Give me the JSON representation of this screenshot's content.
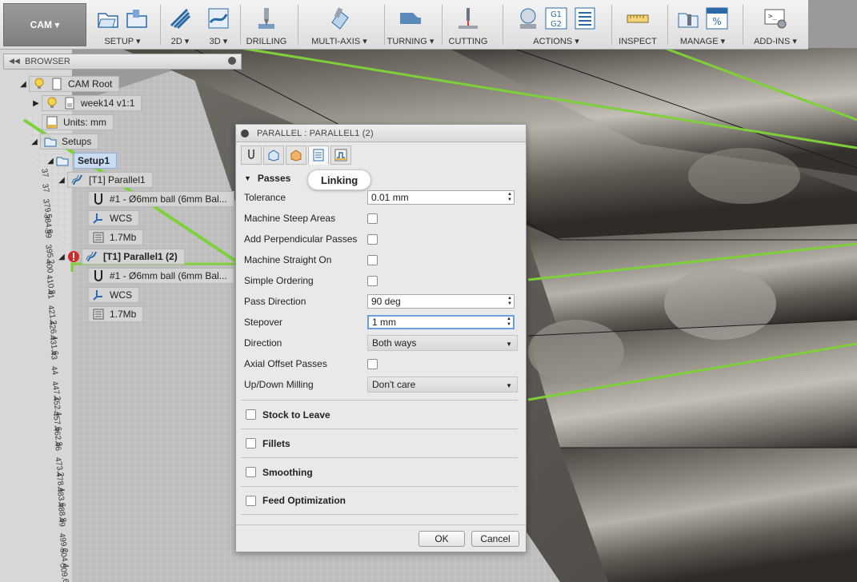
{
  "toolbar": {
    "cam_label": "CAM",
    "groups": [
      {
        "label": "SETUP"
      },
      {
        "label": "2D"
      },
      {
        "label": "3D"
      },
      {
        "label": "DRILLING"
      },
      {
        "label": "MULTI-AXIS"
      },
      {
        "label": "TURNING"
      },
      {
        "label": "CUTTING"
      },
      {
        "label": "ACTIONS"
      },
      {
        "label": "INSPECT"
      },
      {
        "label": "MANAGE"
      },
      {
        "label": "ADD-INS"
      }
    ]
  },
  "browser": {
    "title": "BROWSER",
    "items": [
      {
        "label": "CAM Root"
      },
      {
        "label": "week14 v1:1"
      },
      {
        "label": "Units: mm"
      },
      {
        "label": "Setups"
      },
      {
        "label": "Setup1"
      },
      {
        "label": "[T1] Parallel1"
      },
      {
        "label": "#1 - Ø6mm ball (6mm Bal..."
      },
      {
        "label": "WCS"
      },
      {
        "label": "1.7Mb"
      },
      {
        "label": "[T1] Parallel1 (2)"
      },
      {
        "label": "#1 - Ø6mm ball (6mm Bal..."
      },
      {
        "label": "WCS"
      },
      {
        "label": "1.7Mb"
      }
    ]
  },
  "ruler_ticks": [
    "37",
    "37 ",
    "379,5",
    "384,8",
    "39",
    "395,2",
    "400",
    "410,8",
    "41",
    "421,2",
    "426,4",
    "431,6",
    "43",
    "44",
    "447,2",
    "452,4",
    "457,6",
    "462,8",
    "46",
    "473,2",
    "478,4",
    "483,6",
    "488,8",
    "49",
    "499,2",
    "504,4",
    "509,6"
  ],
  "dialog": {
    "title": "PARALLEL : PARALLEL1 (2)",
    "tooltip": "Linking",
    "passes_header": "Passes",
    "fields": {
      "tolerance": {
        "label": "Tolerance",
        "value": "0.01 mm"
      },
      "steep": {
        "label": "Machine Steep Areas"
      },
      "perp": {
        "label": "Add Perpendicular Passes"
      },
      "straight": {
        "label": "Machine Straight On"
      },
      "ordering": {
        "label": "Simple Ordering"
      },
      "pass_dir": {
        "label": "Pass Direction",
        "value": "90 deg"
      },
      "stepover": {
        "label": "Stepover",
        "value": "1 mm"
      },
      "direction": {
        "label": "Direction",
        "value": "Both ways"
      },
      "axial": {
        "label": "Axial Offset Passes"
      },
      "updown": {
        "label": "Up/Down Milling",
        "value": "Don't care"
      }
    },
    "groups": {
      "stock": "Stock to Leave",
      "fillets": "Fillets",
      "smoothing": "Smoothing",
      "feed": "Feed Optimization"
    },
    "ok": "OK",
    "cancel": "Cancel"
  },
  "colors": {
    "highlight_green": "#7ed03a",
    "selection_blue": "#c9dcf2",
    "error_red": "#d62828"
  }
}
